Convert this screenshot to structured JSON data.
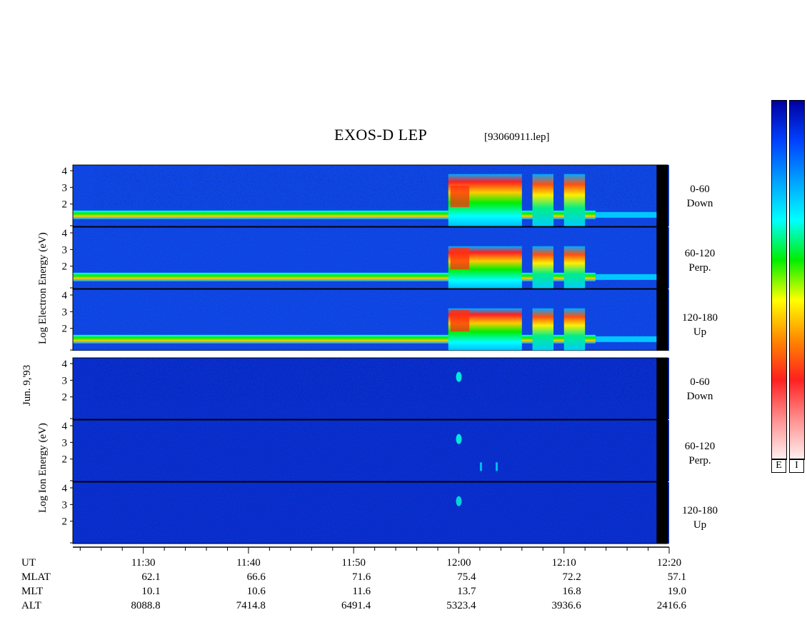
{
  "title": "EXOS-D LEP",
  "filename": "[93060911.lep]",
  "date_label": "Jun. 9,'93",
  "electron_group": {
    "ylabel": "Log  Electron  Energy  (eV)",
    "panels": [
      {
        "id": "e-down",
        "range": "0-60",
        "dir": "Down"
      },
      {
        "id": "e-perp",
        "range": "60-120",
        "dir": "Perp."
      },
      {
        "id": "e-up",
        "range": "120-180",
        "dir": "Up"
      }
    ]
  },
  "ion_group": {
    "ylabel": "Log  Ion  Energy  (eV)",
    "panels": [
      {
        "id": "i-down",
        "range": "0-60",
        "dir": "Down"
      },
      {
        "id": "i-perp",
        "range": "60-120",
        "dir": "Perp."
      },
      {
        "id": "i-up",
        "range": "120-180",
        "dir": "Up"
      }
    ]
  },
  "colorbar": {
    "labels": [
      "E",
      "I"
    ],
    "colors": [
      "#fff0f0",
      "#ff9090",
      "#ff2020",
      "#ff8800",
      "#ffff00",
      "#00ee00",
      "#00ffff",
      "#00a0ff",
      "#0040ff",
      "#0000a0"
    ]
  },
  "chart_data": {
    "type": "heatmap",
    "title": "EXOS-D LEP",
    "ylabel_electron": "Log Electron Energy (eV)",
    "ylabel_ion": "Log Ion Energy (eV)",
    "yticks": [
      "1",
      "2",
      "3",
      "4"
    ],
    "ylim": [
      1,
      4
    ],
    "x_ticks": [
      "11:30",
      "11:40",
      "11:50",
      "12:00",
      "12:10",
      "12:20"
    ],
    "ephemeris": {
      "labels": [
        "UT",
        "MLAT",
        "MLT",
        "ALT"
      ],
      "UT": [
        "11:30",
        "11:40",
        "11:50",
        "12:00",
        "12:10",
        "12:20"
      ],
      "MLAT": [
        "62.1",
        "66.6",
        "71.6",
        "75.4",
        "72.2",
        "57.1"
      ],
      "MLT": [
        "10.1",
        "10.6",
        "11.6",
        "13.7",
        "16.8",
        "19.0"
      ],
      "ALT": [
        "8088.8",
        "7414.8",
        "6491.4",
        "5323.4",
        "3936.6",
        "2416.6"
      ]
    },
    "electron_burst_windows_UT": [
      "11:59-12:06",
      "12:07-12:09",
      "12:10-12:12"
    ],
    "panels": [
      "0-60 Down",
      "60-120 Perp.",
      "120-180 Up"
    ]
  }
}
